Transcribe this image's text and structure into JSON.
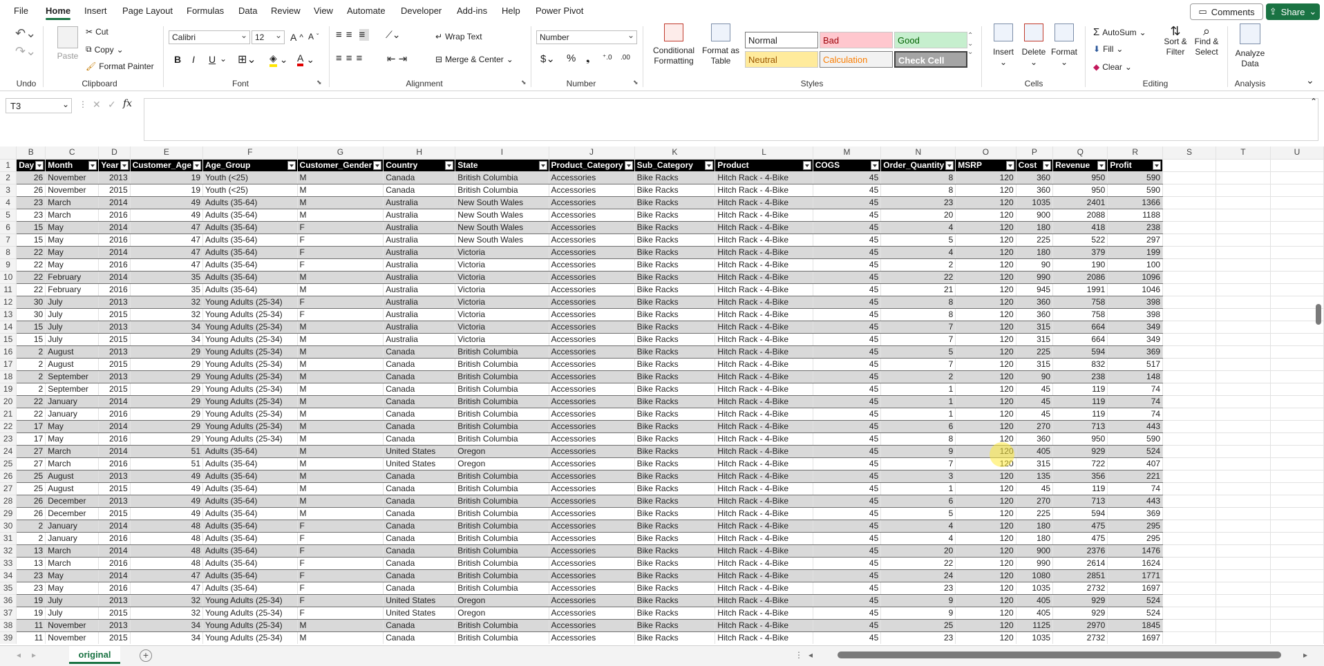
{
  "menu": {
    "tabs": [
      "File",
      "Home",
      "Insert",
      "Page Layout",
      "Formulas",
      "Data",
      "Review",
      "View",
      "Automate",
      "Developer",
      "Add-ins",
      "Help",
      "Power Pivot"
    ],
    "active": "Home",
    "comments": "Comments",
    "share": "Share"
  },
  "ribbon": {
    "undo_group": "Undo",
    "clipboard": {
      "paste": "Paste",
      "cut": "Cut",
      "copy": "Copy",
      "format_painter": "Format Painter",
      "label": "Clipboard"
    },
    "font": {
      "name": "Calibri",
      "size": "12",
      "label": "Font",
      "bold": "B",
      "italic": "I",
      "underline": "U"
    },
    "alignment": {
      "wrap": "Wrap Text",
      "merge": "Merge & Center",
      "label": "Alignment"
    },
    "number": {
      "format": "Number",
      "label": "Number"
    },
    "styles": {
      "conditional": "Conditional\nFormatting",
      "format_table": "Format as\nTable",
      "cells": [
        "Normal",
        "Bad",
        "Good",
        "Neutral",
        "Calculation",
        "Check Cell"
      ],
      "label": "Styles"
    },
    "cells": {
      "insert": "Insert",
      "delete": "Delete",
      "format": "Format",
      "label": "Cells"
    },
    "editing": {
      "autosum": "AutoSum",
      "fill": "Fill",
      "clear": "Clear",
      "sort": "Sort &\nFilter",
      "find": "Find &\nSelect",
      "label": "Editing"
    },
    "analysis": {
      "analyze": "Analyze\nData",
      "label": "Analysis"
    }
  },
  "formula_bar": {
    "name_box": "T3",
    "fx": "fx",
    "content": ""
  },
  "columns": [
    "B",
    "C",
    "D",
    "E",
    "F",
    "G",
    "H",
    "I",
    "J",
    "K",
    "L",
    "M",
    "N",
    "O",
    "P",
    "Q",
    "R",
    "S",
    "T",
    "U"
  ],
  "headers": [
    "Day",
    "Month",
    "Year",
    "Customer_Age",
    "Age_Group",
    "Customer_Gender",
    "Country",
    "State",
    "Product_Category",
    "Sub_Category",
    "Product",
    "COGS",
    "Order_Quantity",
    "MSRP",
    "Cost",
    "Revenue",
    "Profit"
  ],
  "rows": [
    [
      26,
      "November",
      2013,
      19,
      "Youth (<25)",
      "M",
      "Canada",
      "British Columbia",
      "Accessories",
      "Bike Racks",
      "Hitch Rack - 4-Bike",
      45,
      8,
      120,
      360,
      950,
      590
    ],
    [
      26,
      "November",
      2015,
      19,
      "Youth (<25)",
      "M",
      "Canada",
      "British Columbia",
      "Accessories",
      "Bike Racks",
      "Hitch Rack - 4-Bike",
      45,
      8,
      120,
      360,
      950,
      590
    ],
    [
      23,
      "March",
      2014,
      49,
      "Adults (35-64)",
      "M",
      "Australia",
      "New South Wales",
      "Accessories",
      "Bike Racks",
      "Hitch Rack - 4-Bike",
      45,
      23,
      120,
      1035,
      2401,
      1366
    ],
    [
      23,
      "March",
      2016,
      49,
      "Adults (35-64)",
      "M",
      "Australia",
      "New South Wales",
      "Accessories",
      "Bike Racks",
      "Hitch Rack - 4-Bike",
      45,
      20,
      120,
      900,
      2088,
      1188
    ],
    [
      15,
      "May",
      2014,
      47,
      "Adults (35-64)",
      "F",
      "Australia",
      "New South Wales",
      "Accessories",
      "Bike Racks",
      "Hitch Rack - 4-Bike",
      45,
      4,
      120,
      180,
      418,
      238
    ],
    [
      15,
      "May",
      2016,
      47,
      "Adults (35-64)",
      "F",
      "Australia",
      "New South Wales",
      "Accessories",
      "Bike Racks",
      "Hitch Rack - 4-Bike",
      45,
      5,
      120,
      225,
      522,
      297
    ],
    [
      22,
      "May",
      2014,
      47,
      "Adults (35-64)",
      "F",
      "Australia",
      "Victoria",
      "Accessories",
      "Bike Racks",
      "Hitch Rack - 4-Bike",
      45,
      4,
      120,
      180,
      379,
      199
    ],
    [
      22,
      "May",
      2016,
      47,
      "Adults (35-64)",
      "F",
      "Australia",
      "Victoria",
      "Accessories",
      "Bike Racks",
      "Hitch Rack - 4-Bike",
      45,
      2,
      120,
      90,
      190,
      100
    ],
    [
      22,
      "February",
      2014,
      35,
      "Adults (35-64)",
      "M",
      "Australia",
      "Victoria",
      "Accessories",
      "Bike Racks",
      "Hitch Rack - 4-Bike",
      45,
      22,
      120,
      990,
      2086,
      1096
    ],
    [
      22,
      "February",
      2016,
      35,
      "Adults (35-64)",
      "M",
      "Australia",
      "Victoria",
      "Accessories",
      "Bike Racks",
      "Hitch Rack - 4-Bike",
      45,
      21,
      120,
      945,
      1991,
      1046
    ],
    [
      30,
      "July",
      2013,
      32,
      "Young Adults (25-34)",
      "F",
      "Australia",
      "Victoria",
      "Accessories",
      "Bike Racks",
      "Hitch Rack - 4-Bike",
      45,
      8,
      120,
      360,
      758,
      398
    ],
    [
      30,
      "July",
      2015,
      32,
      "Young Adults (25-34)",
      "F",
      "Australia",
      "Victoria",
      "Accessories",
      "Bike Racks",
      "Hitch Rack - 4-Bike",
      45,
      8,
      120,
      360,
      758,
      398
    ],
    [
      15,
      "July",
      2013,
      34,
      "Young Adults (25-34)",
      "M",
      "Australia",
      "Victoria",
      "Accessories",
      "Bike Racks",
      "Hitch Rack - 4-Bike",
      45,
      7,
      120,
      315,
      664,
      349
    ],
    [
      15,
      "July",
      2015,
      34,
      "Young Adults (25-34)",
      "M",
      "Australia",
      "Victoria",
      "Accessories",
      "Bike Racks",
      "Hitch Rack - 4-Bike",
      45,
      7,
      120,
      315,
      664,
      349
    ],
    [
      2,
      "August",
      2013,
      29,
      "Young Adults (25-34)",
      "M",
      "Canada",
      "British Columbia",
      "Accessories",
      "Bike Racks",
      "Hitch Rack - 4-Bike",
      45,
      5,
      120,
      225,
      594,
      369
    ],
    [
      2,
      "August",
      2015,
      29,
      "Young Adults (25-34)",
      "M",
      "Canada",
      "British Columbia",
      "Accessories",
      "Bike Racks",
      "Hitch Rack - 4-Bike",
      45,
      7,
      120,
      315,
      832,
      517
    ],
    [
      2,
      "September",
      2013,
      29,
      "Young Adults (25-34)",
      "M",
      "Canada",
      "British Columbia",
      "Accessories",
      "Bike Racks",
      "Hitch Rack - 4-Bike",
      45,
      2,
      120,
      90,
      238,
      148
    ],
    [
      2,
      "September",
      2015,
      29,
      "Young Adults (25-34)",
      "M",
      "Canada",
      "British Columbia",
      "Accessories",
      "Bike Racks",
      "Hitch Rack - 4-Bike",
      45,
      1,
      120,
      45,
      119,
      74
    ],
    [
      22,
      "January",
      2014,
      29,
      "Young Adults (25-34)",
      "M",
      "Canada",
      "British Columbia",
      "Accessories",
      "Bike Racks",
      "Hitch Rack - 4-Bike",
      45,
      1,
      120,
      45,
      119,
      74
    ],
    [
      22,
      "January",
      2016,
      29,
      "Young Adults (25-34)",
      "M",
      "Canada",
      "British Columbia",
      "Accessories",
      "Bike Racks",
      "Hitch Rack - 4-Bike",
      45,
      1,
      120,
      45,
      119,
      74
    ],
    [
      17,
      "May",
      2014,
      29,
      "Young Adults (25-34)",
      "M",
      "Canada",
      "British Columbia",
      "Accessories",
      "Bike Racks",
      "Hitch Rack - 4-Bike",
      45,
      6,
      120,
      270,
      713,
      443
    ],
    [
      17,
      "May",
      2016,
      29,
      "Young Adults (25-34)",
      "M",
      "Canada",
      "British Columbia",
      "Accessories",
      "Bike Racks",
      "Hitch Rack - 4-Bike",
      45,
      8,
      120,
      360,
      950,
      590
    ],
    [
      27,
      "March",
      2014,
      51,
      "Adults (35-64)",
      "M",
      "United States",
      "Oregon",
      "Accessories",
      "Bike Racks",
      "Hitch Rack - 4-Bike",
      45,
      9,
      120,
      405,
      929,
      524
    ],
    [
      27,
      "March",
      2016,
      51,
      "Adults (35-64)",
      "M",
      "United States",
      "Oregon",
      "Accessories",
      "Bike Racks",
      "Hitch Rack - 4-Bike",
      45,
      7,
      120,
      315,
      722,
      407
    ],
    [
      25,
      "August",
      2013,
      49,
      "Adults (35-64)",
      "M",
      "Canada",
      "British Columbia",
      "Accessories",
      "Bike Racks",
      "Hitch Rack - 4-Bike",
      45,
      3,
      120,
      135,
      356,
      221
    ],
    [
      25,
      "August",
      2015,
      49,
      "Adults (35-64)",
      "M",
      "Canada",
      "British Columbia",
      "Accessories",
      "Bike Racks",
      "Hitch Rack - 4-Bike",
      45,
      1,
      120,
      45,
      119,
      74
    ],
    [
      26,
      "December",
      2013,
      49,
      "Adults (35-64)",
      "M",
      "Canada",
      "British Columbia",
      "Accessories",
      "Bike Racks",
      "Hitch Rack - 4-Bike",
      45,
      6,
      120,
      270,
      713,
      443
    ],
    [
      26,
      "December",
      2015,
      49,
      "Adults (35-64)",
      "M",
      "Canada",
      "British Columbia",
      "Accessories",
      "Bike Racks",
      "Hitch Rack - 4-Bike",
      45,
      5,
      120,
      225,
      594,
      369
    ],
    [
      2,
      "January",
      2014,
      48,
      "Adults (35-64)",
      "F",
      "Canada",
      "British Columbia",
      "Accessories",
      "Bike Racks",
      "Hitch Rack - 4-Bike",
      45,
      4,
      120,
      180,
      475,
      295
    ],
    [
      2,
      "January",
      2016,
      48,
      "Adults (35-64)",
      "F",
      "Canada",
      "British Columbia",
      "Accessories",
      "Bike Racks",
      "Hitch Rack - 4-Bike",
      45,
      4,
      120,
      180,
      475,
      295
    ],
    [
      13,
      "March",
      2014,
      48,
      "Adults (35-64)",
      "F",
      "Canada",
      "British Columbia",
      "Accessories",
      "Bike Racks",
      "Hitch Rack - 4-Bike",
      45,
      20,
      120,
      900,
      2376,
      1476
    ],
    [
      13,
      "March",
      2016,
      48,
      "Adults (35-64)",
      "F",
      "Canada",
      "British Columbia",
      "Accessories",
      "Bike Racks",
      "Hitch Rack - 4-Bike",
      45,
      22,
      120,
      990,
      2614,
      1624
    ],
    [
      23,
      "May",
      2014,
      47,
      "Adults (35-64)",
      "F",
      "Canada",
      "British Columbia",
      "Accessories",
      "Bike Racks",
      "Hitch Rack - 4-Bike",
      45,
      24,
      120,
      1080,
      2851,
      1771
    ],
    [
      23,
      "May",
      2016,
      47,
      "Adults (35-64)",
      "F",
      "Canada",
      "British Columbia",
      "Accessories",
      "Bike Racks",
      "Hitch Rack - 4-Bike",
      45,
      23,
      120,
      1035,
      2732,
      1697
    ],
    [
      19,
      "July",
      2013,
      32,
      "Young Adults (25-34)",
      "F",
      "United States",
      "Oregon",
      "Accessories",
      "Bike Racks",
      "Hitch Rack - 4-Bike",
      45,
      9,
      120,
      405,
      929,
      524
    ],
    [
      19,
      "July",
      2015,
      32,
      "Young Adults (25-34)",
      "F",
      "United States",
      "Oregon",
      "Accessories",
      "Bike Racks",
      "Hitch Rack - 4-Bike",
      45,
      9,
      120,
      405,
      929,
      524
    ],
    [
      11,
      "November",
      2013,
      34,
      "Young Adults (25-34)",
      "M",
      "Canada",
      "British Columbia",
      "Accessories",
      "Bike Racks",
      "Hitch Rack - 4-Bike",
      45,
      25,
      120,
      1125,
      2970,
      1845
    ],
    [
      11,
      "November",
      2015,
      34,
      "Young Adults (25-34)",
      "M",
      "Canada",
      "British Columbia",
      "Accessories",
      "Bike Racks",
      "Hitch Rack - 4-Bike",
      45,
      23,
      120,
      1035,
      2732,
      1697
    ]
  ],
  "sheet": {
    "tab": "original",
    "add": "+"
  },
  "colors": {
    "excel_green": "#1a7343",
    "band": "#d9d9d9",
    "header_bg": "#000000"
  }
}
